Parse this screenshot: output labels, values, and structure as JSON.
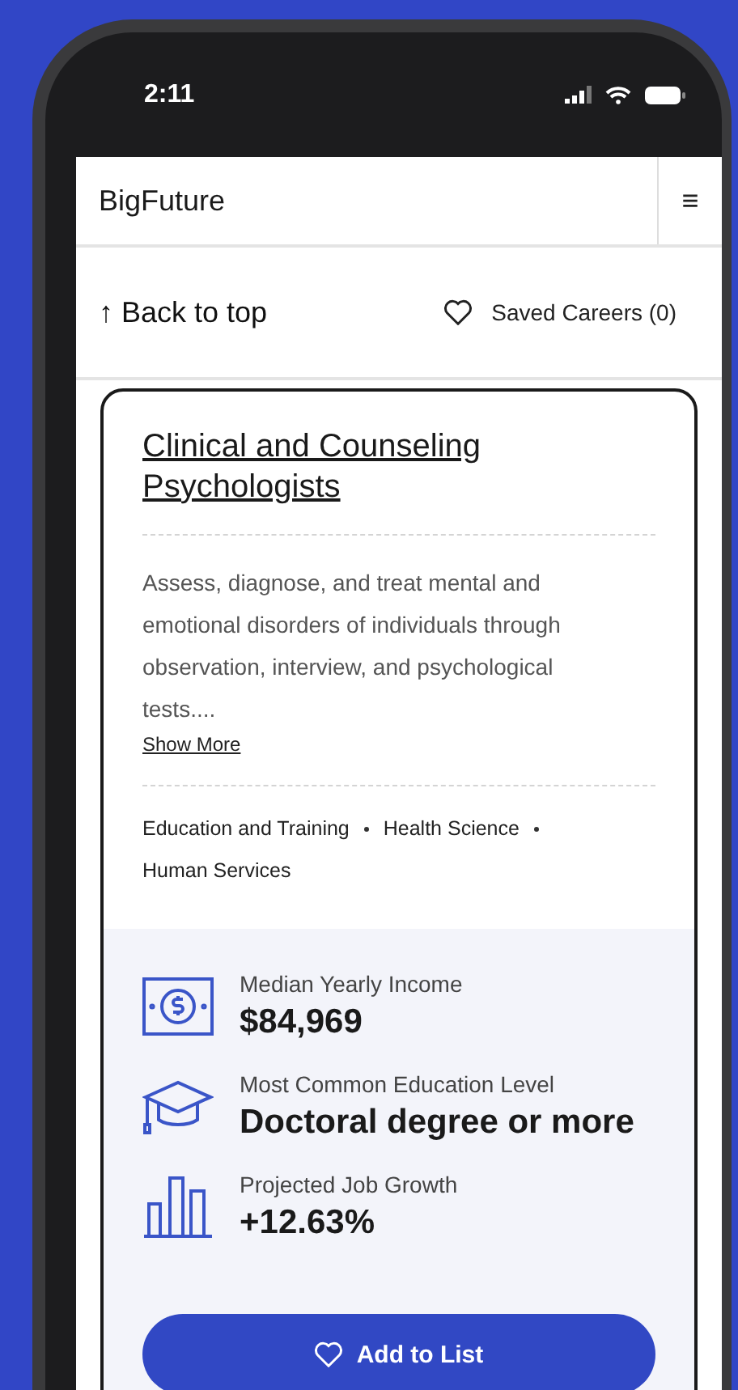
{
  "status_bar": {
    "time": "2:11"
  },
  "header": {
    "title": "BigFuture",
    "menu": "≡"
  },
  "toolbar": {
    "back": "↑ Back to top",
    "saved": "Saved Careers (0)"
  },
  "career": {
    "title": "Clinical and Counseling Psychologists",
    "description": "Assess, diagnose, and treat mental and emotional disorders of individuals through observation, interview, and psychological tests....",
    "show_more": "Show More",
    "clusters": [
      "Education and Training",
      "Health Science",
      "Human Services"
    ],
    "stats": [
      {
        "kind": "income",
        "label": "Median Yearly Income",
        "value": "$84,969"
      },
      {
        "kind": "education",
        "label": "Most Common Education Level",
        "value": "Doctoral degree or more"
      },
      {
        "kind": "growth",
        "label": "Projected Job Growth",
        "value": "+12.63%"
      }
    ],
    "button": "Add to List"
  }
}
